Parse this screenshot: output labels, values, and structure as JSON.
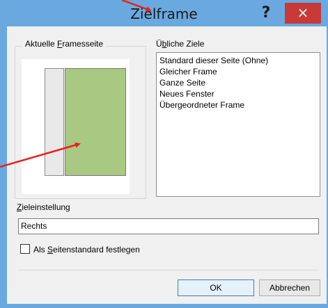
{
  "window": {
    "title": "Zielframe",
    "help_glyph": "?",
    "close_glyph": "×"
  },
  "current_frames_page": {
    "legend_prefix": "Aktuelle ",
    "legend_underlined": "F",
    "legend_suffix": "ramesseite"
  },
  "common_targets": {
    "label_prefix": "Ü",
    "label_underlined": "b",
    "label_suffix": "liche Ziele",
    "items": [
      {
        "label": "Standard dieser Seite (Ohne)"
      },
      {
        "label": "Gleicher Frame"
      },
      {
        "label": "Ganze Seite"
      },
      {
        "label": "Neues Fenster"
      },
      {
        "label": "Übergeordneter Frame"
      }
    ]
  },
  "target_setting": {
    "label_underlined": "Z",
    "label_suffix": "ieleinstellung",
    "value": "Rechts"
  },
  "set_as_default": {
    "label_prefix": "Als ",
    "label_underlined": "S",
    "label_suffix": "eitenstandard festlegen",
    "checked": false
  },
  "buttons": {
    "ok_label": "OK",
    "cancel_label": "Abbrechen"
  },
  "colors": {
    "title_bar": "#6aa9df",
    "close_button": "#c73a38",
    "selected_frame": "#a9c982",
    "annotation_arrow": "#e8211e"
  }
}
